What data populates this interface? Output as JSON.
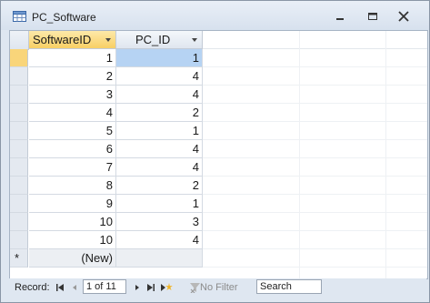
{
  "window": {
    "title": "PC_Software"
  },
  "table": {
    "columns": [
      "SoftwareID",
      "PC_ID"
    ],
    "rows": [
      [
        "1",
        "1"
      ],
      [
        "2",
        "4"
      ],
      [
        "3",
        "4"
      ],
      [
        "4",
        "2"
      ],
      [
        "5",
        "1"
      ],
      [
        "6",
        "4"
      ],
      [
        "7",
        "4"
      ],
      [
        "8",
        "2"
      ],
      [
        "9",
        "1"
      ],
      [
        "10",
        "3"
      ],
      [
        "10",
        "4"
      ]
    ],
    "new_row_label": "(New)",
    "new_row_marker": "*"
  },
  "navigator": {
    "record_label": "Record:",
    "record_position": "1 of 11",
    "filter_label": "No Filter",
    "search_placeholder": "Search"
  },
  "colors": {
    "selected_row_marker": "#f9d57a",
    "active_header": "#f8cf64",
    "selected_cell": "#b6d3f3"
  },
  "icons": [
    "table-icon",
    "minimize-icon",
    "restore-icon",
    "close-icon",
    "dropdown-arrow-icon",
    "first-record-icon",
    "previous-record-icon",
    "next-record-icon",
    "last-record-icon",
    "new-record-icon",
    "filter-icon"
  ]
}
